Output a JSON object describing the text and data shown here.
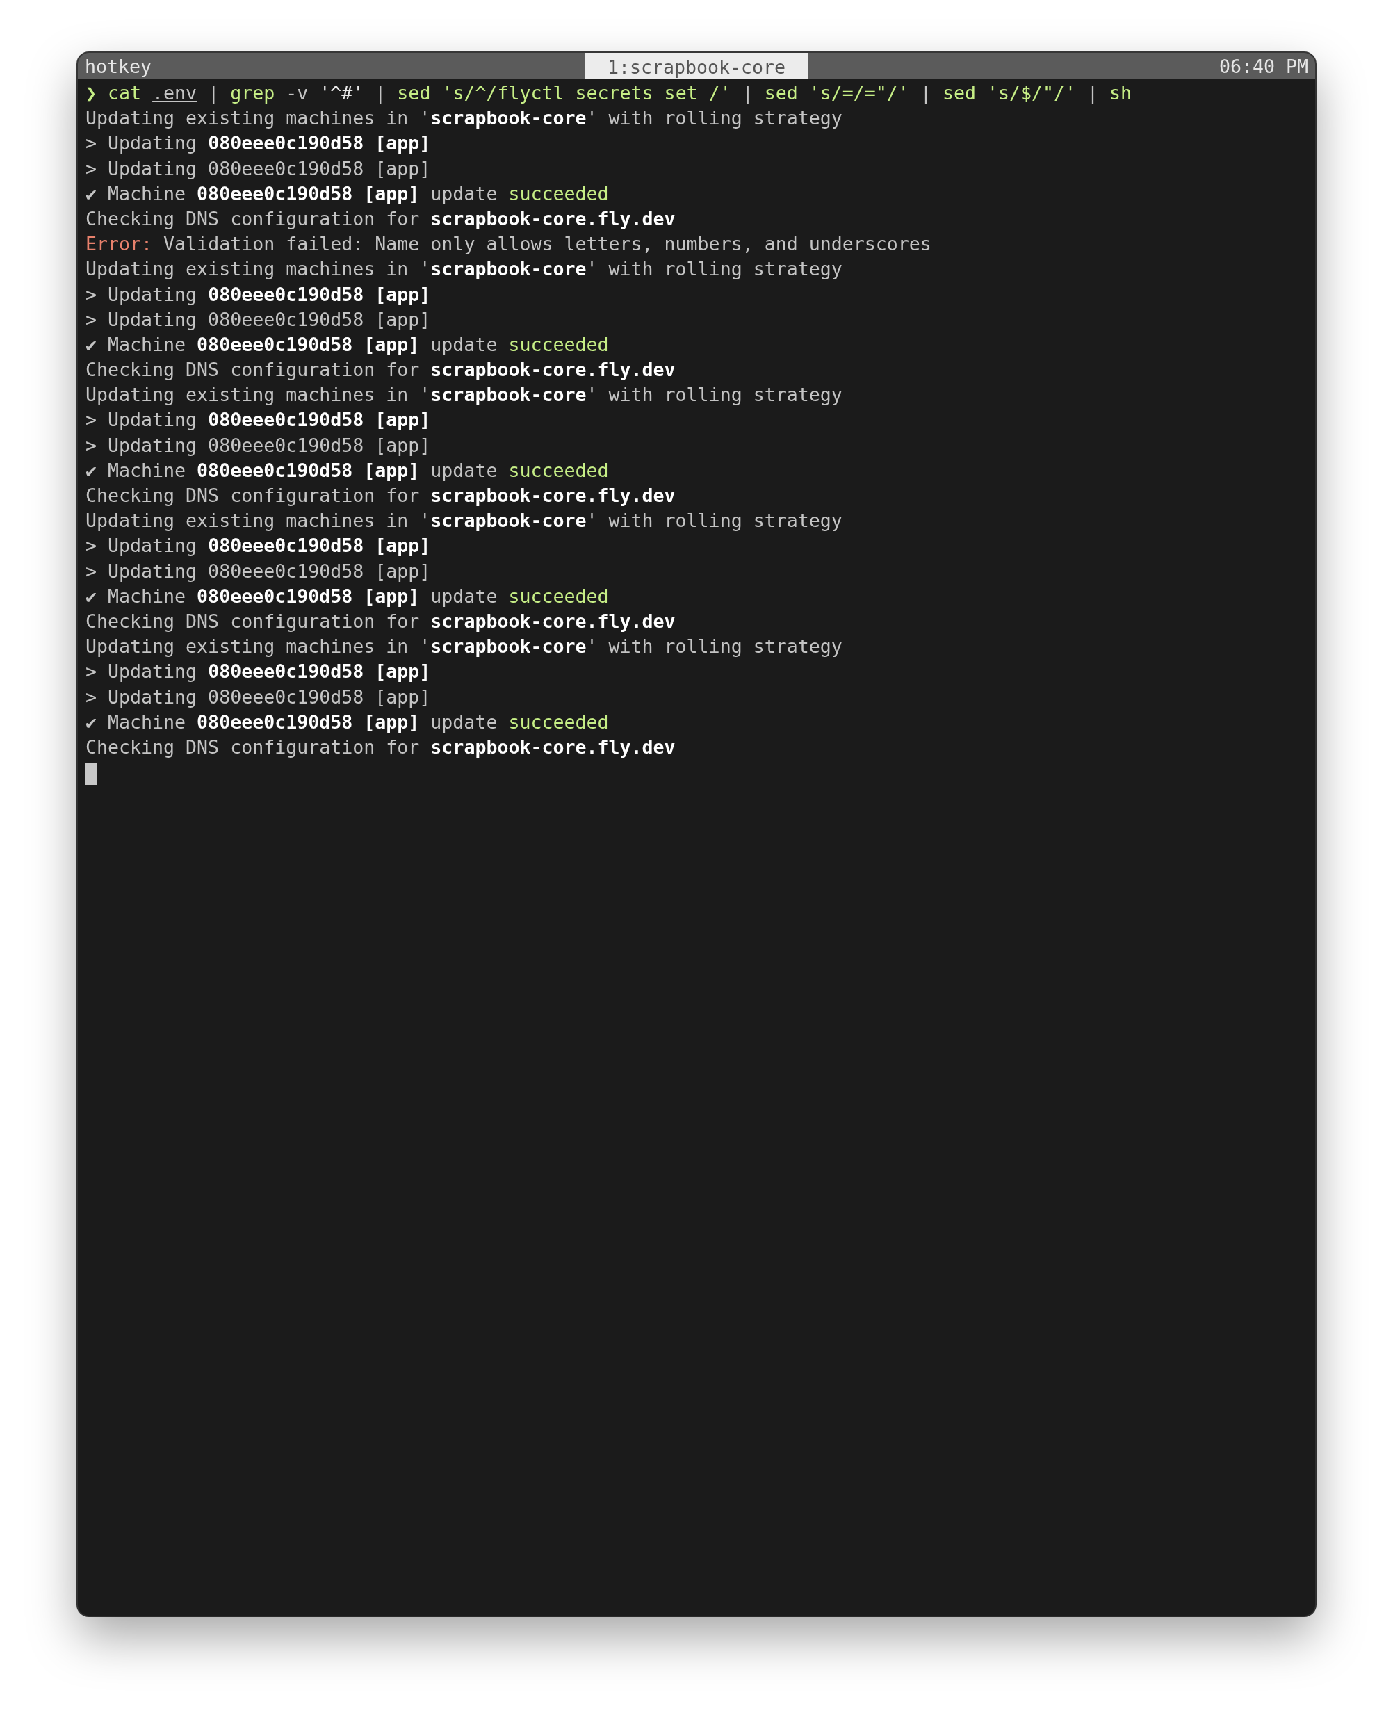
{
  "status_bar": {
    "session": "hotkey",
    "tabs": [
      {
        "label": "1:scrapbook-core",
        "selected": true
      }
    ],
    "clock": "06:40 PM"
  },
  "lines": [
    {
      "segments": [
        {
          "text": "❯ cat ",
          "kind": "command"
        },
        {
          "text": ".env",
          "kind": "path"
        },
        {
          "text": " | ",
          "kind": "plain"
        },
        {
          "text": "grep",
          "kind": "command"
        },
        {
          "text": " -v ",
          "kind": "plain"
        },
        {
          "text": "'^#'",
          "kind": "argument"
        },
        {
          "text": " | ",
          "kind": "plain"
        },
        {
          "text": "sed 's/^/flyctl secrets set /'",
          "kind": "command"
        },
        {
          "text": " | ",
          "kind": "plain"
        },
        {
          "text": "sed 's/=/=\"/'",
          "kind": "command"
        },
        {
          "text": " | ",
          "kind": "plain"
        },
        {
          "text": "sed 's/$/\"/'",
          "kind": "command"
        },
        {
          "text": " | ",
          "kind": "plain"
        },
        {
          "text": "sh",
          "kind": "command"
        }
      ]
    },
    {
      "segments": [
        {
          "text": "Updating existing machines in '",
          "kind": "plain"
        },
        {
          "text": "scrapbook-core",
          "kind": "bold"
        },
        {
          "text": "' with rolling strategy",
          "kind": "plain"
        }
      ]
    },
    {
      "segments": [
        {
          "text": "> Updating ",
          "kind": "plain"
        },
        {
          "text": "080eee0c190d58 [app]",
          "kind": "bold"
        }
      ]
    },
    {
      "segments": [
        {
          "text": "> Updating 080eee0c190d58 [app]",
          "kind": "plain"
        }
      ]
    },
    {
      "segments": [
        {
          "text": "✔ Machine ",
          "kind": "plain"
        },
        {
          "text": "080eee0c190d58 [app]",
          "kind": "bold"
        },
        {
          "text": " update ",
          "kind": "plain"
        },
        {
          "text": "succeeded",
          "kind": "success"
        }
      ]
    },
    {
      "segments": [
        {
          "text": "Checking DNS configuration for ",
          "kind": "plain"
        },
        {
          "text": "scrapbook-core.fly.dev",
          "kind": "bold"
        }
      ]
    },
    {
      "segments": [
        {
          "text": "Error:",
          "kind": "error"
        },
        {
          "text": " Validation failed: Name only allows letters, numbers, and underscores",
          "kind": "plain"
        }
      ]
    },
    {
      "segments": [
        {
          "text": "Updating existing machines in '",
          "kind": "plain"
        },
        {
          "text": "scrapbook-core",
          "kind": "bold"
        },
        {
          "text": "' with rolling strategy",
          "kind": "plain"
        }
      ]
    },
    {
      "segments": [
        {
          "text": "> Updating ",
          "kind": "plain"
        },
        {
          "text": "080eee0c190d58 [app]",
          "kind": "bold"
        }
      ]
    },
    {
      "segments": [
        {
          "text": "> Updating 080eee0c190d58 [app]",
          "kind": "plain"
        }
      ]
    },
    {
      "segments": [
        {
          "text": "✔ Machine ",
          "kind": "plain"
        },
        {
          "text": "080eee0c190d58 [app]",
          "kind": "bold"
        },
        {
          "text": " update ",
          "kind": "plain"
        },
        {
          "text": "succeeded",
          "kind": "success"
        }
      ]
    },
    {
      "segments": [
        {
          "text": "Checking DNS configuration for ",
          "kind": "plain"
        },
        {
          "text": "scrapbook-core.fly.dev",
          "kind": "bold"
        }
      ]
    },
    {
      "segments": [
        {
          "text": "Updating existing machines in '",
          "kind": "plain"
        },
        {
          "text": "scrapbook-core",
          "kind": "bold"
        },
        {
          "text": "' with rolling strategy",
          "kind": "plain"
        }
      ]
    },
    {
      "segments": [
        {
          "text": "> Updating ",
          "kind": "plain"
        },
        {
          "text": "080eee0c190d58 [app]",
          "kind": "bold"
        }
      ]
    },
    {
      "segments": [
        {
          "text": "> Updating 080eee0c190d58 [app]",
          "kind": "plain"
        }
      ]
    },
    {
      "segments": [
        {
          "text": "✔ Machine ",
          "kind": "plain"
        },
        {
          "text": "080eee0c190d58 [app]",
          "kind": "bold"
        },
        {
          "text": " update ",
          "kind": "plain"
        },
        {
          "text": "succeeded",
          "kind": "success"
        }
      ]
    },
    {
      "segments": [
        {
          "text": "Checking DNS configuration for ",
          "kind": "plain"
        },
        {
          "text": "scrapbook-core.fly.dev",
          "kind": "bold"
        }
      ]
    },
    {
      "segments": [
        {
          "text": "Updating existing machines in '",
          "kind": "plain"
        },
        {
          "text": "scrapbook-core",
          "kind": "bold"
        },
        {
          "text": "' with rolling strategy",
          "kind": "plain"
        }
      ]
    },
    {
      "segments": [
        {
          "text": "> Updating ",
          "kind": "plain"
        },
        {
          "text": "080eee0c190d58 [app]",
          "kind": "bold"
        }
      ]
    },
    {
      "segments": [
        {
          "text": "> Updating 080eee0c190d58 [app]",
          "kind": "plain"
        }
      ]
    },
    {
      "segments": [
        {
          "text": "✔ Machine ",
          "kind": "plain"
        },
        {
          "text": "080eee0c190d58 [app]",
          "kind": "bold"
        },
        {
          "text": " update ",
          "kind": "plain"
        },
        {
          "text": "succeeded",
          "kind": "success"
        }
      ]
    },
    {
      "segments": [
        {
          "text": "Checking DNS configuration for ",
          "kind": "plain"
        },
        {
          "text": "scrapbook-core.fly.dev",
          "kind": "bold"
        }
      ]
    },
    {
      "segments": [
        {
          "text": "Updating existing machines in '",
          "kind": "plain"
        },
        {
          "text": "scrapbook-core",
          "kind": "bold"
        },
        {
          "text": "' with rolling strategy",
          "kind": "plain"
        }
      ]
    },
    {
      "segments": [
        {
          "text": "> Updating ",
          "kind": "plain"
        },
        {
          "text": "080eee0c190d58 [app]",
          "kind": "bold"
        }
      ]
    },
    {
      "segments": [
        {
          "text": "> Updating 080eee0c190d58 [app]",
          "kind": "plain"
        }
      ]
    },
    {
      "segments": [
        {
          "text": "✔ Machine ",
          "kind": "plain"
        },
        {
          "text": "080eee0c190d58 [app]",
          "kind": "bold"
        },
        {
          "text": " update ",
          "kind": "plain"
        },
        {
          "text": "succeeded",
          "kind": "success"
        }
      ]
    },
    {
      "segments": [
        {
          "text": "Checking DNS configuration for ",
          "kind": "plain"
        },
        {
          "text": "scrapbook-core.fly.dev",
          "kind": "bold"
        }
      ]
    }
  ],
  "cursor": {
    "visible": true
  }
}
